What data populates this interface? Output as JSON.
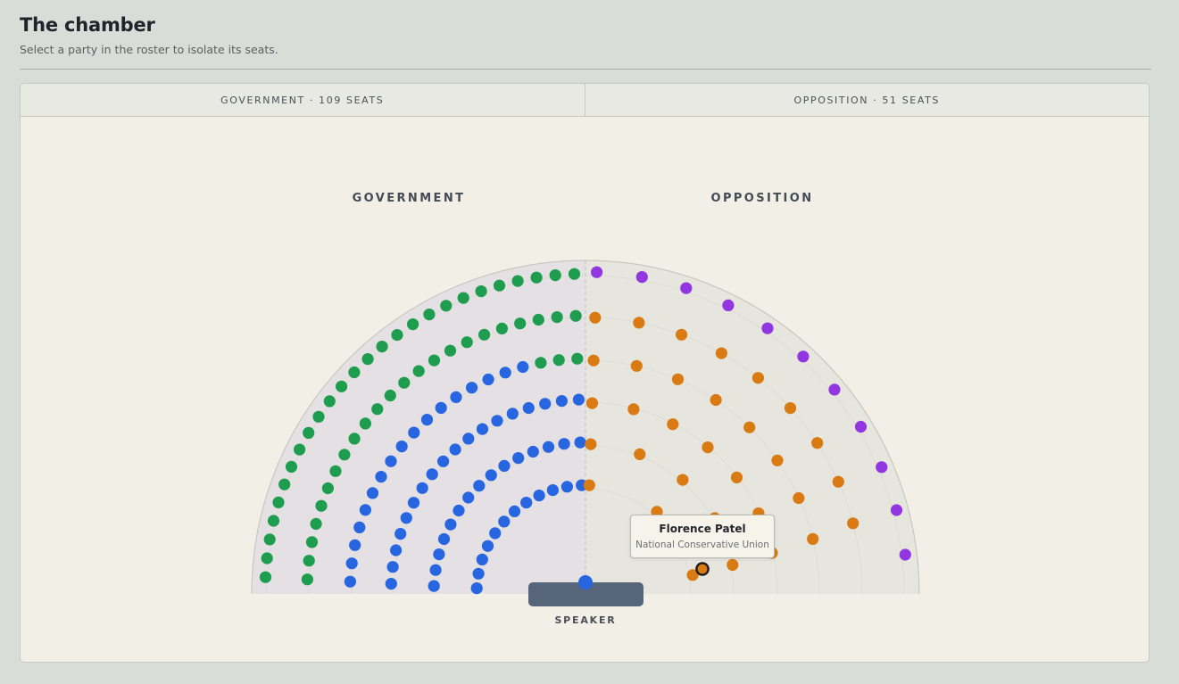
{
  "header": {
    "title": "The chamber",
    "subtitle": "Select a party in the roster to isolate its seats."
  },
  "tabs": [
    {
      "label": "GOVERNMENT · 109 SEATS"
    },
    {
      "label": "OPPOSITION · 51 SEATS"
    }
  ],
  "chamber": {
    "government_label": "GOVERNMENT",
    "opposition_label": "OPPOSITION",
    "speaker_label": "SPEAKER",
    "colors": {
      "government_zone": "#e4e0e4",
      "opposition_zone": "#e6e5de",
      "green_party": "#1f9d4f",
      "blue_party": "#2766e0",
      "orange_party": "#d97b12",
      "purple_party": "#9136e0",
      "speaker_bar": "#566579"
    }
  },
  "tooltip": {
    "name": "Florence Patel",
    "party": "National Conservative Union"
  }
}
